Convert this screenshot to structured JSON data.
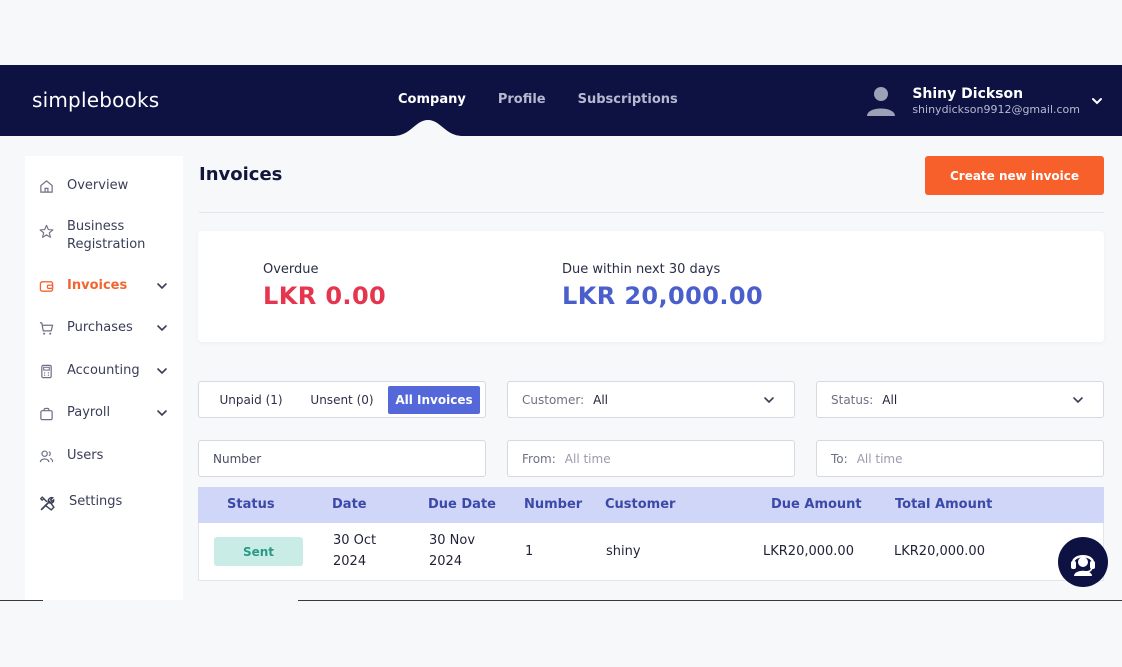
{
  "app": {
    "logo": "simplebooks"
  },
  "nav": {
    "items": [
      {
        "label": "Company",
        "active": true
      },
      {
        "label": "Profile",
        "active": false
      },
      {
        "label": "Subscriptions",
        "active": false
      }
    ]
  },
  "user": {
    "name": "Shiny Dickson",
    "email": "shinydickson9912@gmail.com",
    "avatar_icon": "user-avatar-icon"
  },
  "sidebar": {
    "items": [
      {
        "label": "Overview",
        "icon": "home-icon"
      },
      {
        "label": "Business Registration",
        "icon": "star-icon"
      },
      {
        "label": "Invoices",
        "icon": "wallet-icon",
        "active": true
      },
      {
        "label": "Purchases",
        "icon": "cart-icon"
      },
      {
        "label": "Accounting",
        "icon": "calculator-icon"
      },
      {
        "label": "Payroll",
        "icon": "bag-icon"
      },
      {
        "label": "Users",
        "icon": "users-icon"
      },
      {
        "label": "Settings",
        "icon": "tools-icon"
      }
    ]
  },
  "main": {
    "title": "Invoices",
    "create_button": "Create new invoice",
    "summary": {
      "overdue_label": "Overdue",
      "overdue_value": "LKR 0.00",
      "due_label": "Due within next 30 days",
      "due_value": "LKR 20,000.00"
    },
    "tabs": [
      {
        "label": "Unpaid (1)"
      },
      {
        "label": "Unsent (0)"
      },
      {
        "label": "All Invoices",
        "active": true
      }
    ],
    "filters": {
      "customer_label": "Customer:",
      "customer_value": "All",
      "status_label": "Status:",
      "status_value": "All",
      "number_placeholder": "Number",
      "from_label": "From:",
      "from_placeholder": "All time",
      "to_label": "To:",
      "to_placeholder": "All time"
    },
    "table": {
      "headers": [
        "Status",
        "Date",
        "Due Date",
        "Number",
        "Customer",
        "Due Amount",
        "Total Amount"
      ],
      "rows": [
        {
          "status": "Sent",
          "date_line1": "30 Oct",
          "date_line2": "2024",
          "due_line1": "30 Nov",
          "due_line2": "2024",
          "number": "1",
          "customer": "shiny",
          "due_amount": "LKR20,000.00",
          "total_amount": "LKR20,000.00"
        }
      ]
    }
  },
  "colors": {
    "header_bg": "#0e1243",
    "accent_orange": "#f7602b",
    "overdue_red": "#e5354f",
    "due_blue": "#4b5fcc",
    "tab_active": "#5468d9",
    "table_head": "#cfd6f7",
    "badge_sent_bg": "#c9ede6"
  },
  "help": {
    "icon": "support-agent-icon"
  }
}
